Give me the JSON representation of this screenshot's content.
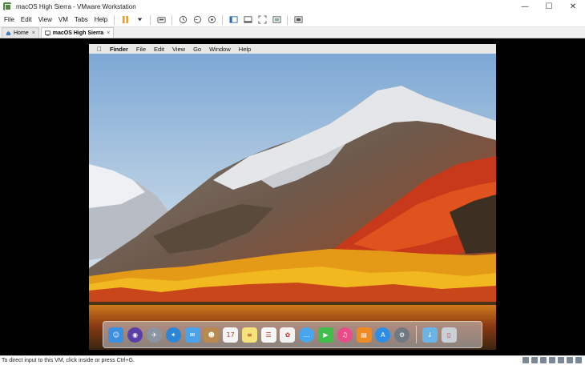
{
  "window": {
    "title": "macOS High Sierra - VMware Workstation",
    "minimize_glyph": "—",
    "maximize_glyph": "☐",
    "close_glyph": "✕"
  },
  "menu": {
    "items": [
      "File",
      "Edit",
      "View",
      "VM",
      "Tabs",
      "Help"
    ]
  },
  "tabs": [
    {
      "label": "Home",
      "close": "×",
      "active": false
    },
    {
      "label": "macOS High Sierra",
      "close": "×",
      "active": true
    }
  ],
  "guest": {
    "menubar": {
      "apple_glyph": "",
      "items": [
        "Finder",
        "File",
        "Edit",
        "View",
        "Go",
        "Window",
        "Help"
      ]
    },
    "dock": {
      "apps": [
        {
          "icon": "finder-icon",
          "color": "#3b8fe0",
          "glyph": "☺"
        },
        {
          "icon": "siri-icon",
          "color": "#5a3ea8",
          "glyph": "◉"
        },
        {
          "icon": "launchpad-icon",
          "color": "#8a96a4",
          "glyph": "✈"
        },
        {
          "icon": "safari-icon",
          "color": "#2a86d8",
          "glyph": "✶"
        },
        {
          "icon": "mail-icon",
          "color": "#4aa3e8",
          "glyph": "✉"
        },
        {
          "icon": "contacts-icon",
          "color": "#b88a4e",
          "glyph": "☻"
        },
        {
          "icon": "calendar-icon",
          "color": "#f4f4f4",
          "glyph": "17"
        },
        {
          "icon": "notes-icon",
          "color": "#f6e27a",
          "glyph": "≡"
        },
        {
          "icon": "reminders-icon",
          "color": "#f7f7f7",
          "glyph": "☰"
        },
        {
          "icon": "photos-icon",
          "color": "#f2f2f2",
          "glyph": "✿"
        },
        {
          "icon": "messages-icon",
          "color": "#46a7ef",
          "glyph": "…"
        },
        {
          "icon": "facetime-icon",
          "color": "#3fbe4a",
          "glyph": "▶"
        },
        {
          "icon": "itunes-icon",
          "color": "#ea4c89",
          "glyph": "♫"
        },
        {
          "icon": "ibooks-icon",
          "color": "#f08a24",
          "glyph": "▤"
        },
        {
          "icon": "app-store-icon",
          "color": "#2c8de6",
          "glyph": "A"
        },
        {
          "icon": "system-preferences-icon",
          "color": "#707880",
          "glyph": "⚙"
        }
      ],
      "right_items": [
        {
          "icon": "downloads-folder-icon",
          "color": "#6bb4e8",
          "glyph": "↓"
        },
        {
          "icon": "trash-icon",
          "color": "#c9d0d8",
          "glyph": "▯"
        }
      ]
    }
  },
  "status": {
    "text": "To direct input to this VM, click inside or press Ctrl+G."
  },
  "colors": {
    "vm_background": "#000000",
    "accent": "#f28c1a"
  }
}
